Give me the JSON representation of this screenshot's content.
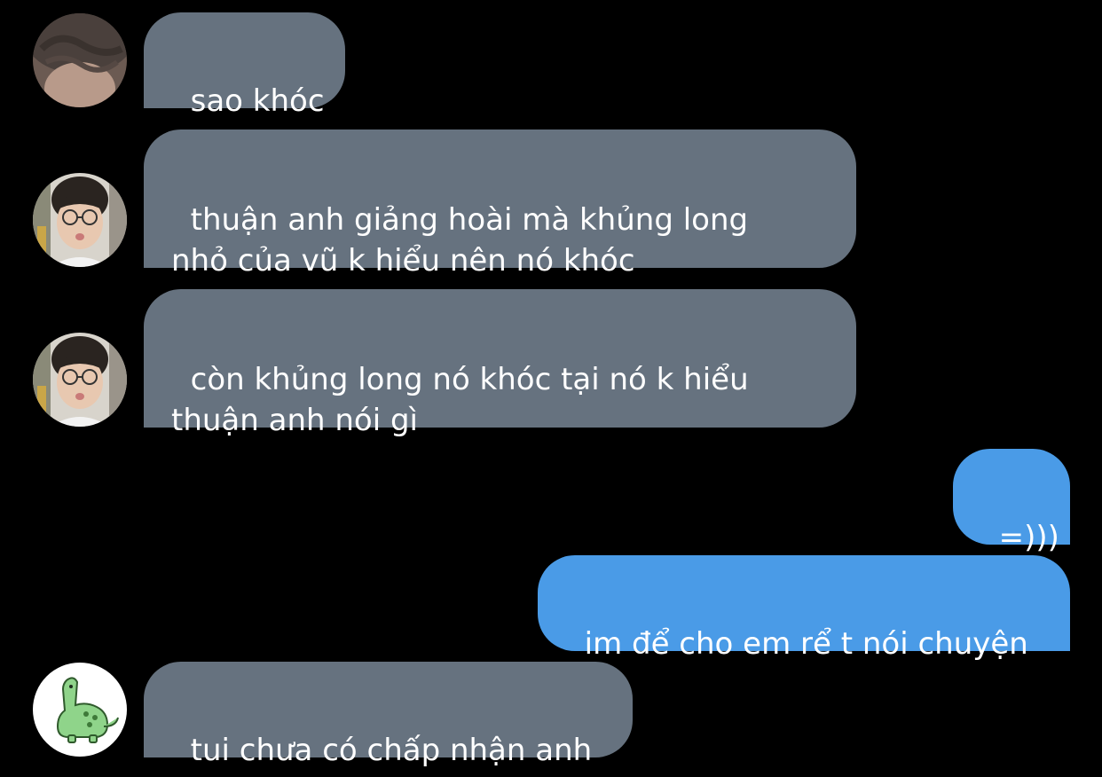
{
  "conversation": {
    "messages": [
      {
        "direction": "incoming",
        "avatar": "avatar-blurred",
        "text": "sao khóc"
      },
      {
        "direction": "incoming",
        "avatar": "avatar-glasses",
        "text": "thuận anh giảng hoài mà khủng long\nnhỏ của vũ k hiểu nên nó khóc"
      },
      {
        "direction": "incoming",
        "avatar": "avatar-glasses",
        "text": "còn khủng long nó khóc tại nó k hiểu\nthuận anh nói gì"
      },
      {
        "direction": "outgoing",
        "text": "=)))"
      },
      {
        "direction": "outgoing",
        "text": "im để cho em rể t nói chuyện"
      },
      {
        "direction": "incoming",
        "avatar": "dinosaur-sticker-avatar",
        "text": "tui chưa có chấp nhận anh"
      }
    ]
  },
  "colors": {
    "background": "#000000",
    "incoming_bubble": "#66727f",
    "outgoing_bubble": "#4a9be7",
    "text": "#ffffff",
    "dinosaur_green": "#8fd48a"
  }
}
